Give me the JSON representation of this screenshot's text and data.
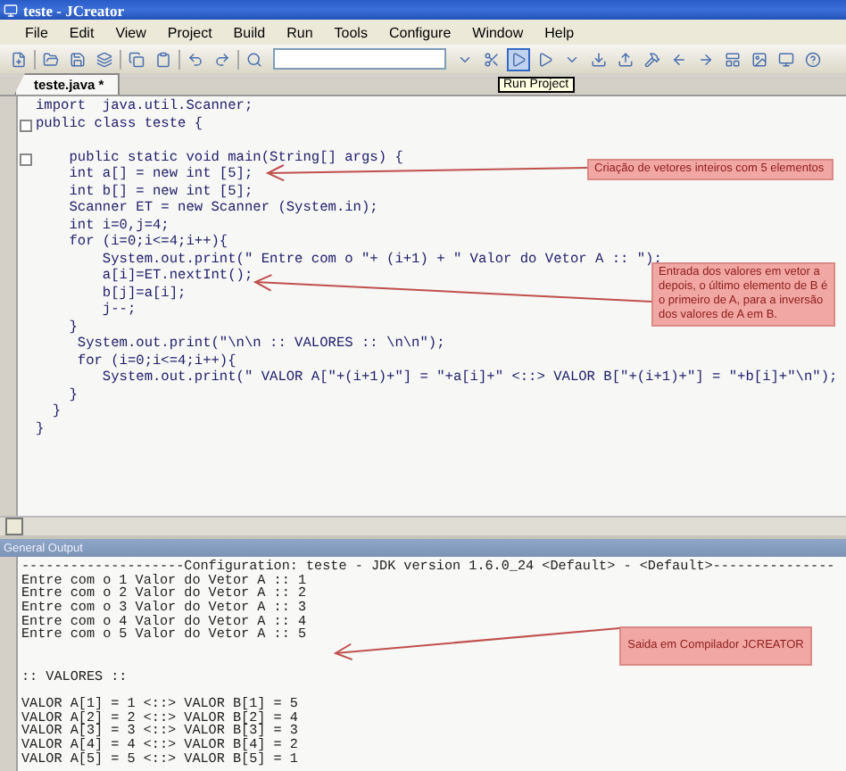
{
  "window": {
    "title": "teste - JCreator"
  },
  "menu": [
    "File",
    "Edit",
    "View",
    "Project",
    "Build",
    "Run",
    "Tools",
    "Configure",
    "Window",
    "Help"
  ],
  "run_project": {
    "tooltip": "Run Project",
    "highlighted": true
  },
  "tabs": [
    {
      "label": "teste.java *",
      "selected": true
    }
  ],
  "editor": {
    "lines": [
      {
        "text": "import  java.util.Scanner;",
        "fold": false
      },
      {
        "text": "public class teste {",
        "fold": true
      },
      {
        "fold": false
      },
      {
        "text": "    public static void main(String[] args) {",
        "fold": true
      },
      {
        "text": "    int a[] = new int [5];",
        "fold": false
      },
      {
        "text": "    int b[] = new int [5];",
        "fold": false
      },
      {
        "text": "    Scanner ET = new Scanner (System.in);",
        "fold": false
      },
      {
        "text": "    int i=0,j=4;",
        "fold": false
      },
      {
        "text": "    for (i=0;i<=4;i++){",
        "fold": false
      },
      {
        "text": "        System.out.print(\" Entre com o \"+ (i+1) + \" Valor do Vetor A :: \");",
        "fold": false
      },
      {
        "text": "        a[i]=ET.nextInt();",
        "fold": false
      },
      {
        "text": "        b[j]=a[i];",
        "fold": false
      },
      {
        "text": "        j--;",
        "fold": false
      },
      {
        "text": "    }",
        "fold": false
      },
      {
        "text": "     System.out.print(\"\\n\\n :: VALORES :: \\n\\n\");",
        "fold": false
      },
      {
        "text": "     for (i=0;i<=4;i++){",
        "fold": false
      },
      {
        "text": "        System.out.print(\" VALOR A[\"+(i+1)+\"] = \"+a[i]+\" <::> VALOR B[\"+(i+1)+\"] = \"+b[i]+\"\\n\");",
        "fold": false
      },
      {
        "text": "    }",
        "fold": false
      },
      {
        "text": "  }",
        "fold": false
      },
      {
        "text": "}",
        "fold": false
      }
    ]
  },
  "output_panel": {
    "title": "General Output",
    "blocks": [
      [
        "--------------------Configuration: teste - JDK version 1.6.0_24 <Default> - <Default>---------------",
        "Entre com o 1 Valor do Vetor A :: 1",
        "Entre com o 2 Valor do Vetor A :: 2",
        "Entre com o 3 Valor do Vetor A :: 3",
        "Entre com o 4 Valor do Vetor A :: 4",
        "Entre com o 5 Valor do Vetor A :: 5"
      ],
      [
        ":: VALORES ::"
      ],
      [
        "VALOR A[1] = 1 <::> VALOR B[1] = 5",
        "VALOR A[2] = 2 <::> VALOR B[2] = 4",
        "VALOR A[3] = 3 <::> VALOR B[3] = 3",
        "VALOR A[4] = 4 <::> VALOR B[4] = 2",
        "VALOR A[5] = 5 <::> VALOR B[5] = 1"
      ]
    ]
  },
  "annotations": [
    {
      "text": "Criação de vetores inteiros com 5 elementos"
    },
    {
      "text": "Entrada dos valores em vetor a depois, o último elemento de B é o primeiro de A, para a inversão dos valores de A em B."
    },
    {
      "text": "Saida em Compilador JCREATOR"
    }
  ]
}
